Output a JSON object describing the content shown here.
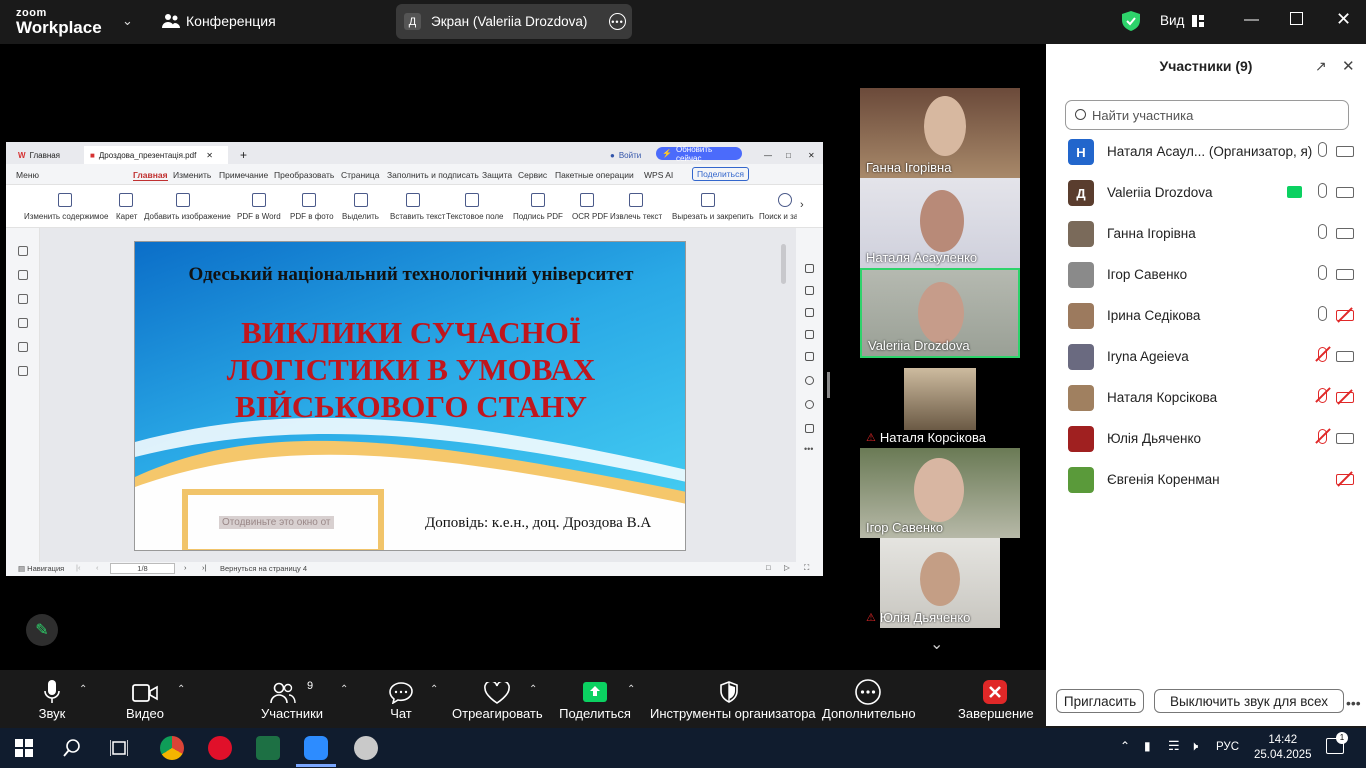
{
  "topbar": {
    "logo_top": "zoom",
    "logo_bottom": "Workplace",
    "meeting_label": "Конференция",
    "share_avatar": "Д",
    "share_title": "Экран (Valeriia Drozdova)",
    "view_label": "Вид"
  },
  "wps": {
    "tabs": [
      "Главная",
      "Дроздова_презентація.pdf"
    ],
    "login": "Войти",
    "update": "Обновить сейчас",
    "menu": [
      "Меню",
      "Главная",
      "Изменить",
      "Примечание",
      "Преобразовать",
      "Страница",
      "Заполнить и подписать",
      "Защита",
      "Сервис",
      "Пакетные операции",
      "WPS AI"
    ],
    "share_btn": "Поделиться",
    "tools": [
      "Изменить содержимое",
      "Карет",
      "Добавить изображение",
      "PDF в Word",
      "PDF в фото",
      "Выделить",
      "Вставить текст",
      "Текстовое поле",
      "Подпись PDF",
      "OCR PDF",
      "Извлечь текст",
      "Вырезать и закрепить",
      "Поиск и зам"
    ],
    "status_nav": "Навигация",
    "status_page": "1/8",
    "status_back": "Вернуться на страницу 4"
  },
  "slide": {
    "university": "Одеський національний технологічний університет",
    "title_lines": [
      "ВИКЛИКИ СУЧАСНОЇ",
      "ЛОГІСТИКИ В УМОВАХ",
      "ВІЙСЬКОВОГО СТАНУ"
    ],
    "author": "Доповідь: к.е.н., доц. Дроздова В.А",
    "stamp": "Отодвиньте это окно от"
  },
  "videos": [
    {
      "name": "Ганна Ігорівна",
      "muted": false
    },
    {
      "name": "Наталя Асауленко",
      "muted": false
    },
    {
      "name": "Valeriia Drozdova",
      "muted": false
    },
    {
      "name": "Наталя Корсікова",
      "muted": true
    },
    {
      "name": "Ігор Савенко",
      "muted": false
    },
    {
      "name": "Юлія Дьяченко",
      "muted": true
    }
  ],
  "panel": {
    "title": "Участники (9)",
    "search_placeholder": "Найти участника",
    "participants": [
      {
        "avatar": "Н",
        "name": "Наталя Асаул...  (Организатор, я)",
        "color": "#2266cc",
        "mic_muted": false,
        "cam_off": false
      },
      {
        "avatar": "Д",
        "name": "Valeriia Drozdova",
        "color": "#5a3d2e",
        "mic_muted": false,
        "cam_off": false
      },
      {
        "avatar": "",
        "name": "Ганна Ігорівна",
        "color": "#7a6a5a",
        "mic_muted": false,
        "cam_off": false
      },
      {
        "avatar": "",
        "name": "Ігор Савенко",
        "color": "#8a8a8a",
        "mic_muted": false,
        "cam_off": false
      },
      {
        "avatar": "",
        "name": "Ірина Седікова",
        "color": "#9c7a5e",
        "mic_muted": false,
        "cam_off": true
      },
      {
        "avatar": "",
        "name": "Iryna Ageieva",
        "color": "#6a6a80",
        "mic_muted": true,
        "cam_off": false
      },
      {
        "avatar": "",
        "name": "Наталя Корсікова",
        "color": "#a08060",
        "mic_muted": true,
        "cam_off": true
      },
      {
        "avatar": "",
        "name": "Юлія Дьяченко",
        "color": "#a02020",
        "mic_muted": true,
        "cam_off": false
      },
      {
        "avatar": "",
        "name": "Євгенія  Коренман",
        "color": "#5a9a3a",
        "mic_muted": null,
        "cam_off": true
      }
    ],
    "invite": "Пригласить",
    "mute_all": "Выключить звук для всех"
  },
  "toolbar": {
    "audio": "Звук",
    "video": "Видео",
    "participants": "Участники",
    "participants_count": "9",
    "chat": "Чат",
    "react": "Отреагировать",
    "share": "Поделиться",
    "host_tools": "Инструменты организатора",
    "more": "Дополнительно",
    "end": "Завершение"
  },
  "taskbar": {
    "lang": "РУС",
    "time": "14:42",
    "date": "25.04.2025",
    "notif": "1"
  },
  "colors": {
    "accent_green": "#2ed36b",
    "share_green": "#0bd161",
    "end_red": "#e02828",
    "slide_red": "#c0161d"
  }
}
